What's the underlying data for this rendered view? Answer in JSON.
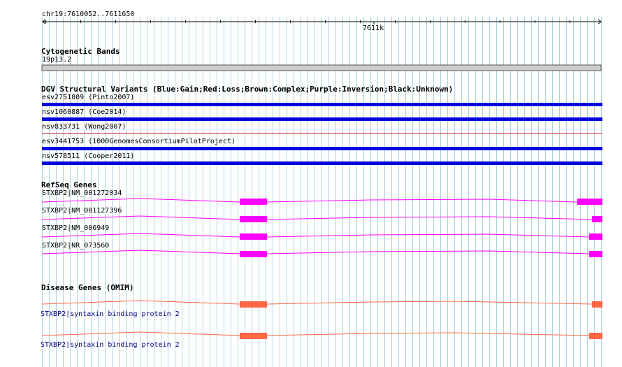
{
  "ruler": {
    "range_label": "chr19:7610052..7611650",
    "tick_label": "7611k"
  },
  "tracks": {
    "cyto": {
      "title": "Cytogenetic Bands",
      "band": "19p13.2"
    },
    "dgv": {
      "title": "DGV Structural Variants (Blue:Gain;Red:Loss;Brown:Complex;Purple:Inversion;Black:Unknown)",
      "items": [
        {
          "label": "esv2751809 (Pinto2007)",
          "type": "Gain",
          "color": "#0000dd"
        },
        {
          "label": "nsv1060887 (Coe2014)",
          "type": "Gain",
          "color": "#0000dd"
        },
        {
          "label": "nsv833731 (Wong2007)",
          "type": "Loss",
          "color": "#cc2222"
        },
        {
          "label": "esv3441753 (1000GenomesConsortiumPilotProject)",
          "type": "Gain",
          "color": "#0000dd"
        },
        {
          "label": "nsv578511 (Cooper2011)",
          "type": "Gain",
          "color": "#0000dd"
        }
      ]
    },
    "refseq": {
      "title": "RefSeq Genes",
      "color": "#ff00ff",
      "items": [
        {
          "label": "STXBP2|NM_001272034"
        },
        {
          "label": "STXBP2|NM_001127396"
        },
        {
          "label": "STXBP2|NM_006949"
        },
        {
          "label": "STXBP2|NR_073560"
        }
      ]
    },
    "omim": {
      "title": "Disease Genes (OMIM)",
      "color": "#ff6644",
      "items": [
        {
          "label": "STXBP2|syntaxin binding protein 2"
        },
        {
          "label": "STXBP2|syntaxin binding protein 2"
        }
      ]
    }
  },
  "colors": {
    "grid": "#aed4e2",
    "axis": "#000000",
    "band_fill": "#cccccc"
  }
}
